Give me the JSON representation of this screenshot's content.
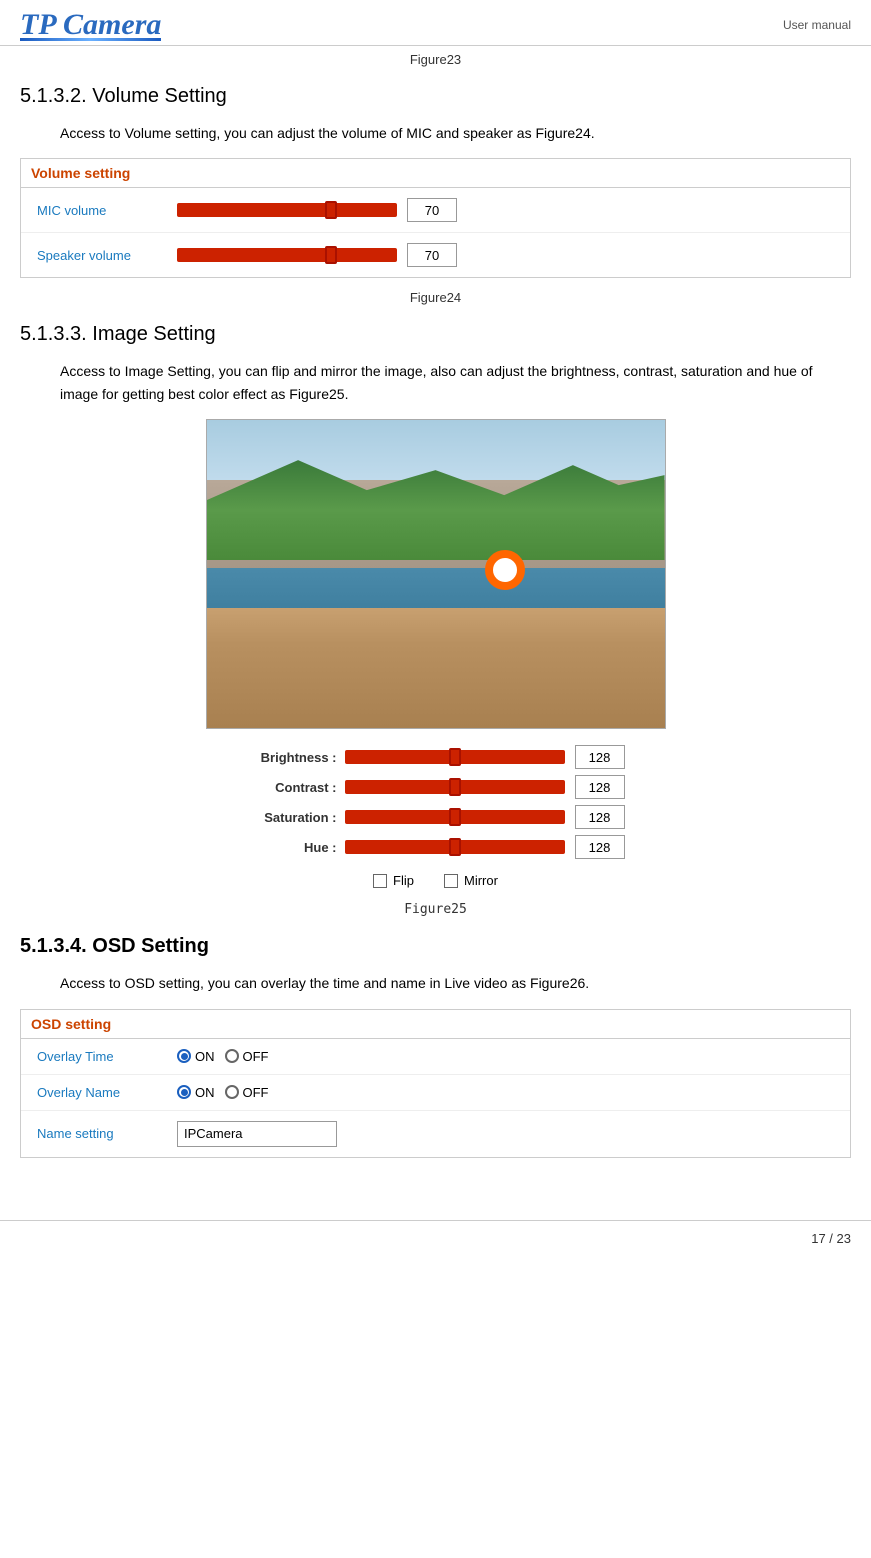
{
  "header": {
    "logo": "TP Camera",
    "manual_label": "User manual"
  },
  "figure23_caption": "Figure23",
  "section_volume": {
    "heading": "5.1.3.2. Volume Setting",
    "intro": "Access to Volume setting, you can adjust the volume of MIC and speaker as Figure24.",
    "panel_title": "Volume setting",
    "rows": [
      {
        "label": "MIC volume",
        "value": "70"
      },
      {
        "label": "Speaker volume",
        "value": "70"
      }
    ],
    "figure_caption": "Figure24"
  },
  "section_image": {
    "heading": "5.1.3.3. Image Setting",
    "intro": "Access to Image Setting, you can flip and mirror the image, also can adjust the brightness, contrast, saturation and hue of image for getting best color effect as Figure25.",
    "controls": [
      {
        "label": "Brightness :",
        "value": "128"
      },
      {
        "label": "Contrast :",
        "value": "128"
      },
      {
        "label": "Saturation :",
        "value": "128"
      },
      {
        "label": "Hue :",
        "value": "128"
      }
    ],
    "flip_label": "Flip",
    "mirror_label": "Mirror",
    "figure_caption": "Figure25"
  },
  "section_osd": {
    "heading": "5.1.3.4. OSD Setting",
    "intro": "Access to OSD setting, you can overlay the time and name in Live video as Figure26.",
    "panel_title": "OSD setting",
    "rows": [
      {
        "label": "Overlay Time",
        "on_label": "ON",
        "off_label": "OFF",
        "selected": "on"
      },
      {
        "label": "Overlay Name",
        "on_label": "ON",
        "off_label": "OFF",
        "selected": "on"
      },
      {
        "label": "Name setting",
        "input_value": "IPCamera"
      }
    ]
  },
  "footer": {
    "page": "17 / 23"
  }
}
